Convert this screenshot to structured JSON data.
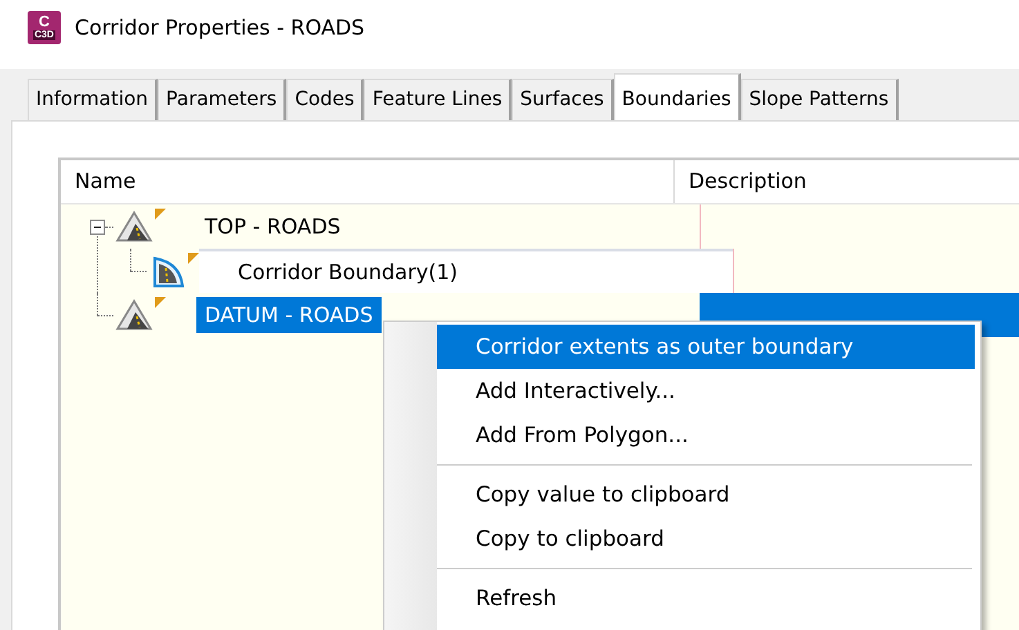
{
  "window": {
    "logo_letter": "C",
    "logo_caption": "C3D",
    "title": "Corridor Properties - ROADS"
  },
  "tabs": [
    {
      "label": "Information",
      "selected": false
    },
    {
      "label": "Parameters",
      "selected": false
    },
    {
      "label": "Codes",
      "selected": false
    },
    {
      "label": "Feature Lines",
      "selected": false
    },
    {
      "label": "Surfaces",
      "selected": false
    },
    {
      "label": "Boundaries",
      "selected": true
    },
    {
      "label": "Slope Patterns",
      "selected": false
    }
  ],
  "table": {
    "columns": [
      "Name",
      "Description"
    ],
    "tree": [
      {
        "name": "TOP - ROADS",
        "kind": "surface",
        "selected": false,
        "expanded": true,
        "children": [
          {
            "name": "Corridor Boundary(1)",
            "kind": "boundary",
            "selected": false
          }
        ]
      },
      {
        "name": "DATUM - ROADS",
        "kind": "surface",
        "selected": true
      }
    ]
  },
  "context_menu": {
    "groups": [
      [
        {
          "label": "Corridor extents as outer boundary",
          "selected": true
        },
        {
          "label": "Add Interactively...",
          "selected": false
        },
        {
          "label": "Add From Polygon...",
          "selected": false
        }
      ],
      [
        {
          "label": "Copy value to clipboard",
          "selected": false
        },
        {
          "label": "Copy to clipboard",
          "selected": false
        }
      ],
      [
        {
          "label": "Refresh",
          "selected": false
        }
      ]
    ]
  }
}
